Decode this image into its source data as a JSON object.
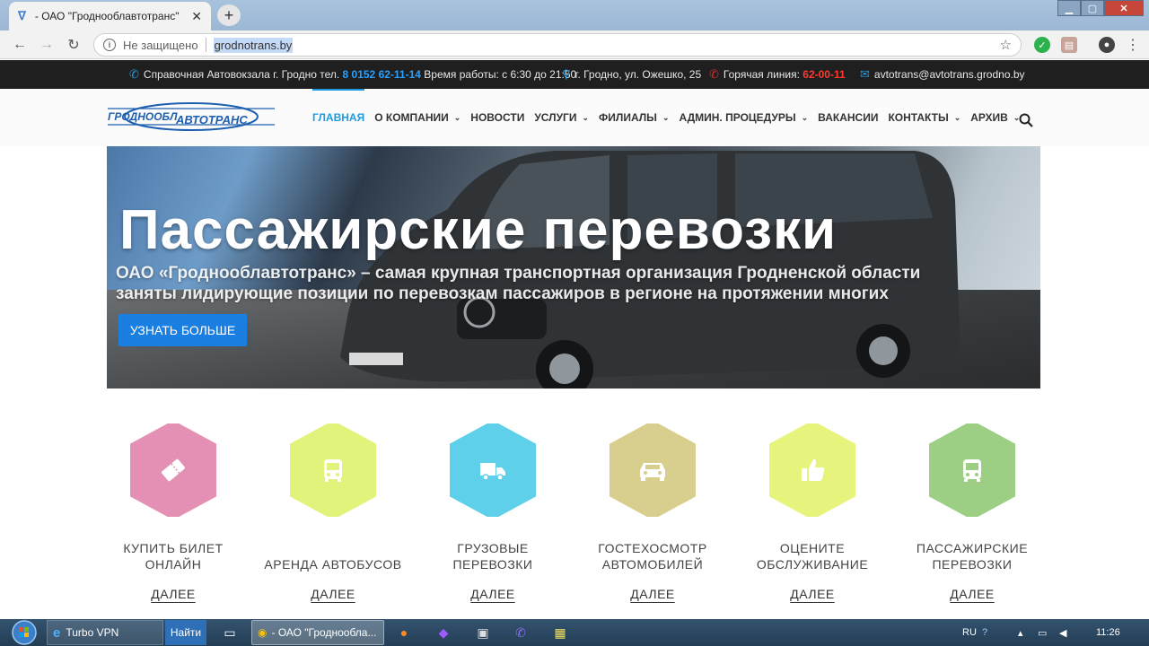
{
  "browser": {
    "tab_title": "- ОАО \"Гроднооблавтотранс\"",
    "security_text": "Не защищено",
    "url": "grodnotrans.by"
  },
  "topbar": {
    "phone_label": "Справочная Автовокзала г. Гродно тел.",
    "phone_number": "8 0152 62-11-14",
    "hours": "Время работы: с 6:30 до 21:50",
    "address": "г. Гродно, ул. Ожешко, 25",
    "hotline_label": "Горячая линия:",
    "hotline_number": "62-00-11",
    "email": "avtotrans@avtotrans.grodno.by"
  },
  "logo": {
    "text1": "ГРОДНООБЛ",
    "text2": "АВТОТРАНС"
  },
  "nav": [
    {
      "label": "ГЛАВНАЯ",
      "active": true,
      "dropdown": false
    },
    {
      "label": "О КОМПАНИИ",
      "active": false,
      "dropdown": true
    },
    {
      "label": "НОВОСТИ",
      "active": false,
      "dropdown": false
    },
    {
      "label": "УСЛУГИ",
      "active": false,
      "dropdown": true
    },
    {
      "label": "ФИЛИАЛЫ",
      "active": false,
      "dropdown": true
    },
    {
      "label": "АДМИН. ПРОЦЕДУРЫ",
      "active": false,
      "dropdown": true
    },
    {
      "label": "ВАКАНСИИ",
      "active": false,
      "dropdown": false
    },
    {
      "label": "КОНТАКТЫ",
      "active": false,
      "dropdown": true
    },
    {
      "label": "АРХИВ",
      "active": false,
      "dropdown": true
    }
  ],
  "hero": {
    "title": "Пассажирские перевозки",
    "subtitle_line1": "ОАО «Гроднооблавтотранс» – самая крупная транспортная организация Гродненской области",
    "subtitle_line2": "заняты лидирующие позиции по перевозкам пассажиров в регионе на протяжении многих",
    "button": "УЗНАТЬ БОЛЬШЕ"
  },
  "services": [
    {
      "line1": "КУПИТЬ БИЛЕТ",
      "line2": "ОНЛАЙН",
      "more": "ДАЛЕЕ",
      "color": "#e48fb4",
      "icon": "ticket-icon"
    },
    {
      "line1": "",
      "line2": "АРЕНДА АВТОБУСОВ",
      "more": "ДАЛЕЕ",
      "color": "#e3f27a",
      "icon": "bus-icon"
    },
    {
      "line1": "ГРУЗОВЫЕ",
      "line2": "ПЕРЕВОЗКИ",
      "more": "ДАЛЕЕ",
      "color": "#5fd0ea",
      "icon": "truck-icon"
    },
    {
      "line1": "ГОСТЕХОСМОТР",
      "line2": "АВТОМОБИЛЕЙ",
      "more": "ДАЛЕЕ",
      "color": "#d8cf8f",
      "icon": "car-icon"
    },
    {
      "line1": "ОЦЕНИТЕ",
      "line2": "ОБСЛУЖИВАНИЕ",
      "more": "ДАЛЕЕ",
      "color": "#e6f47e",
      "icon": "thumbs-up-icon"
    },
    {
      "line1": "ПАССАЖИРСКИЕ",
      "line2": "ПЕРЕВОЗКИ",
      "more": "ДАЛЕЕ",
      "color": "#9ccf84",
      "icon": "bus-icon"
    }
  ],
  "taskbar": {
    "vpn": "Turbo VPN",
    "find": "Найти",
    "chrome_window": "- ОАО \"Гроднообла...",
    "lang": "RU",
    "time": "11:26"
  }
}
